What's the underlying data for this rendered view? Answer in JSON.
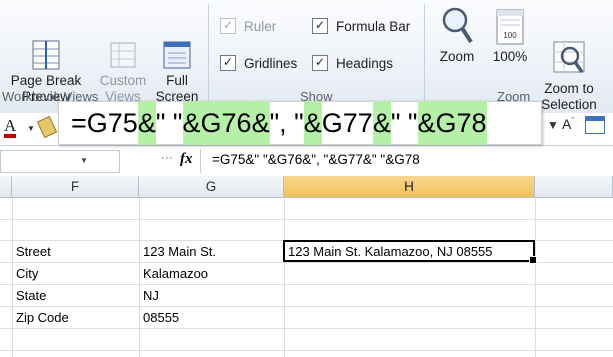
{
  "ribbon": {
    "workbook_views": {
      "group_label": "Workbook Views",
      "page_break": "Page Break\nPreview",
      "custom_views": "Custom\nViews",
      "full_screen": "Full\nScreen"
    },
    "show": {
      "group_label": "Show",
      "ruler": "Ruler",
      "formula_bar": "Formula Bar",
      "gridlines": "Gridlines",
      "headings": "Headings",
      "ruler_checked": true,
      "formula_bar_checked": true,
      "gridlines_checked": true,
      "headings_checked": true
    },
    "zoom": {
      "group_label": "Zoom",
      "zoom": "Zoom",
      "zoom_100": "100%",
      "zoom_to_selection": "Zoom to\nSelection",
      "icon_100_label": "100"
    }
  },
  "callout": {
    "parts": [
      "=G75",
      "&",
      "\" \"",
      "&",
      "G76",
      "&",
      "\", \"",
      "&",
      "G77",
      "&",
      "\" \"",
      "&",
      "G78"
    ]
  },
  "formula_bar": {
    "fx": "fx",
    "formula": "=G75&\" \"&G76&\", \"&G77&\" \"&G78"
  },
  "grid": {
    "columns": [
      "F",
      "G",
      "H"
    ],
    "selected_column": "H",
    "rows": [
      {
        "f": "Street",
        "g": "123 Main St."
      },
      {
        "f": "City",
        "g": "Kalamazoo"
      },
      {
        "f": "State",
        "g": "NJ"
      },
      {
        "f": "Zip Code",
        "g": "08555"
      }
    ],
    "active_cell_value": "123 Main St. Kalamazoo, NJ 08555"
  },
  "colors": {
    "highlight": "#b4f0a6",
    "selected_header": "#f2c05a"
  }
}
